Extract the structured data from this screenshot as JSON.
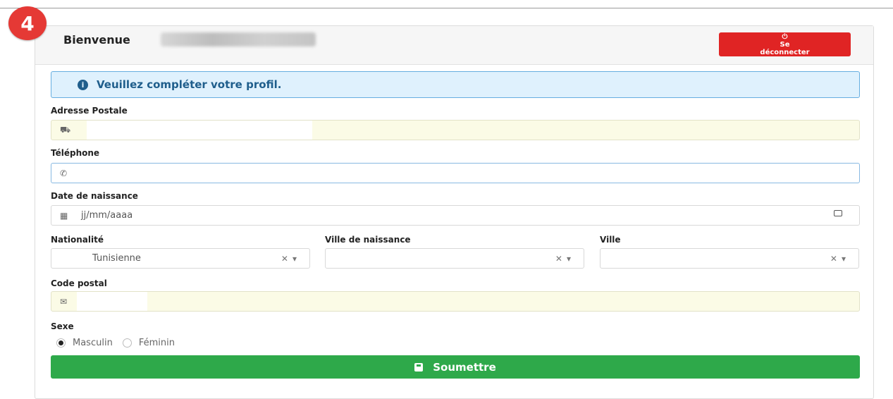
{
  "step": "4",
  "header": {
    "welcome": "Bienvenue",
    "logout_icon": "⏻",
    "logout_line1": "Se",
    "logout_line2": "déconnecter"
  },
  "alert": {
    "text": "Veuillez compléter votre profil."
  },
  "fields": {
    "address": {
      "label": "Adresse Postale",
      "icon": "map-icon"
    },
    "phone": {
      "label": "Téléphone",
      "icon": "phone-icon"
    },
    "birthdate": {
      "label": "Date de naissance",
      "placeholder": "jj/mm/aaaa"
    },
    "nationality": {
      "label": "Nationalité",
      "value": "Tunisienne"
    },
    "birth_city": {
      "label": "Ville de naissance",
      "value": ""
    },
    "city": {
      "label": "Ville",
      "value": ""
    },
    "postal_code": {
      "label": "Code postal",
      "icon": "mailbox-icon"
    }
  },
  "sex": {
    "label": "Sexe",
    "options": [
      {
        "label": "Masculin",
        "checked": true
      },
      {
        "label": "Féminin",
        "checked": false
      }
    ]
  },
  "submit": {
    "label": "Soumettre"
  },
  "colors": {
    "danger": "#e02424",
    "success": "#2ea94a",
    "info_bg": "#dff1fd",
    "info_text": "#1f5e8c"
  }
}
